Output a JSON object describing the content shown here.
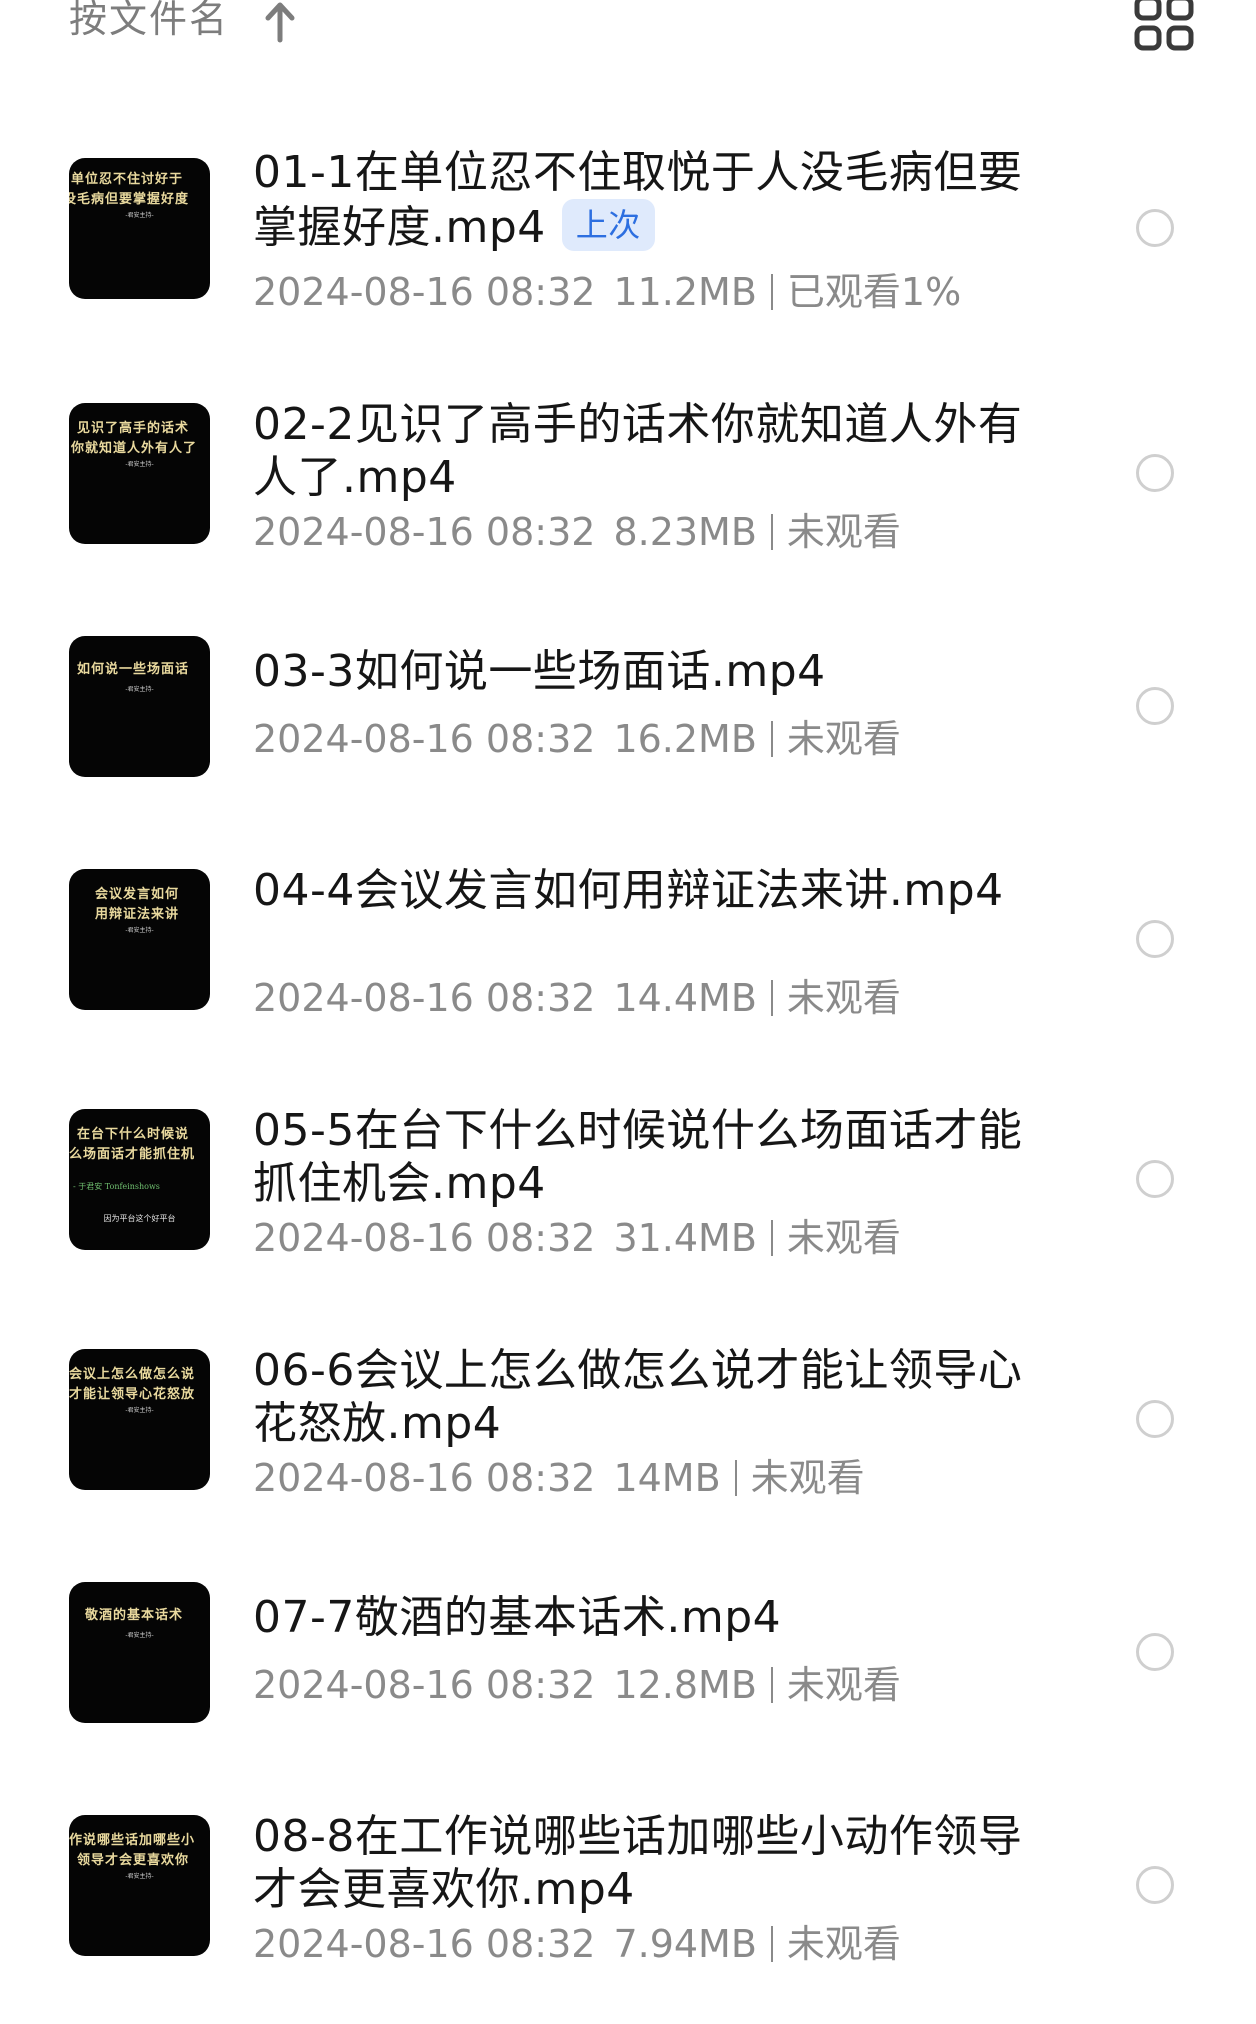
{
  "toolbar": {
    "sort_label": "按文件名",
    "sort_direction_icon": "arrow-up-icon",
    "view_toggle_icon": "grid-view-icon"
  },
  "files": [
    {
      "title": "01-1在单位忍不住取悦于人没毛病但要掌握好度.mp4",
      "badge": "上次",
      "date": "2024-08-16 08:32",
      "size": "11.2MB",
      "status": "已观看1%",
      "thumb_lines": [
        "单位忍不住讨好于",
        "没毛病但要掌握好度"
      ],
      "thumb_sub": "-君安主持-"
    },
    {
      "title": "02-2见识了高手的话术你就知道人外有人了.mp4",
      "badge": "",
      "date": "2024-08-16 08:32",
      "size": "8.23MB",
      "status": "未观看",
      "thumb_lines": [
        "见识了高手的话术",
        "你就知道人外有人了"
      ],
      "thumb_sub": "-君安主持-"
    },
    {
      "title": "03-3如何说一些场面话.mp4",
      "badge": "",
      "date": "2024-08-16 08:32",
      "size": "16.2MB",
      "status": "未观看",
      "thumb_lines": [
        "如何说一些场面话"
      ],
      "thumb_sub": "-君安主持-"
    },
    {
      "title": "04-4会议发言如何用辩证法来讲.mp4",
      "badge": "",
      "date": "2024-08-16 08:32",
      "size": "14.4MB",
      "status": "未观看",
      "thumb_lines": [
        "会议发言如何",
        "用辩证法来讲"
      ],
      "thumb_sub": "-君安主持-"
    },
    {
      "title": "05-5在台下什么时候说什么场面话才能抓住机会.mp4",
      "badge": "",
      "date": "2024-08-16 08:32",
      "size": "31.4MB",
      "status": "未观看",
      "thumb_lines": [
        "在台下什么时候说",
        "么场面话才能抓住机"
      ],
      "thumb_sub": "",
      "thumb_green": "- 于君安  Tonfeinshows",
      "thumb_footer": "因为平台这个好平台"
    },
    {
      "title": "06-6会议上怎么做怎么说才能让领导心花怒放.mp4",
      "badge": "",
      "date": "2024-08-16 08:32",
      "size": "14MB",
      "status": "未观看",
      "thumb_lines": [
        "会议上怎么做怎么说",
        "才能让领导心花怒放"
      ],
      "thumb_sub": "-君安主持-"
    },
    {
      "title": "07-7敬酒的基本话术.mp4",
      "badge": "",
      "date": "2024-08-16 08:32",
      "size": "12.8MB",
      "status": "未观看",
      "thumb_lines": [
        "敬酒的基本话术"
      ],
      "thumb_sub": "-君安主持-"
    },
    {
      "title": "08-8在工作说哪些话加哪些小动作领导才会更喜欢你.mp4",
      "badge": "",
      "date": "2024-08-16 08:32",
      "size": "7.94MB",
      "status": "未观看",
      "thumb_lines": [
        "作说哪些话加哪些小",
        "领导才会更喜欢你"
      ],
      "thumb_sub": "-君安主持-"
    }
  ]
}
